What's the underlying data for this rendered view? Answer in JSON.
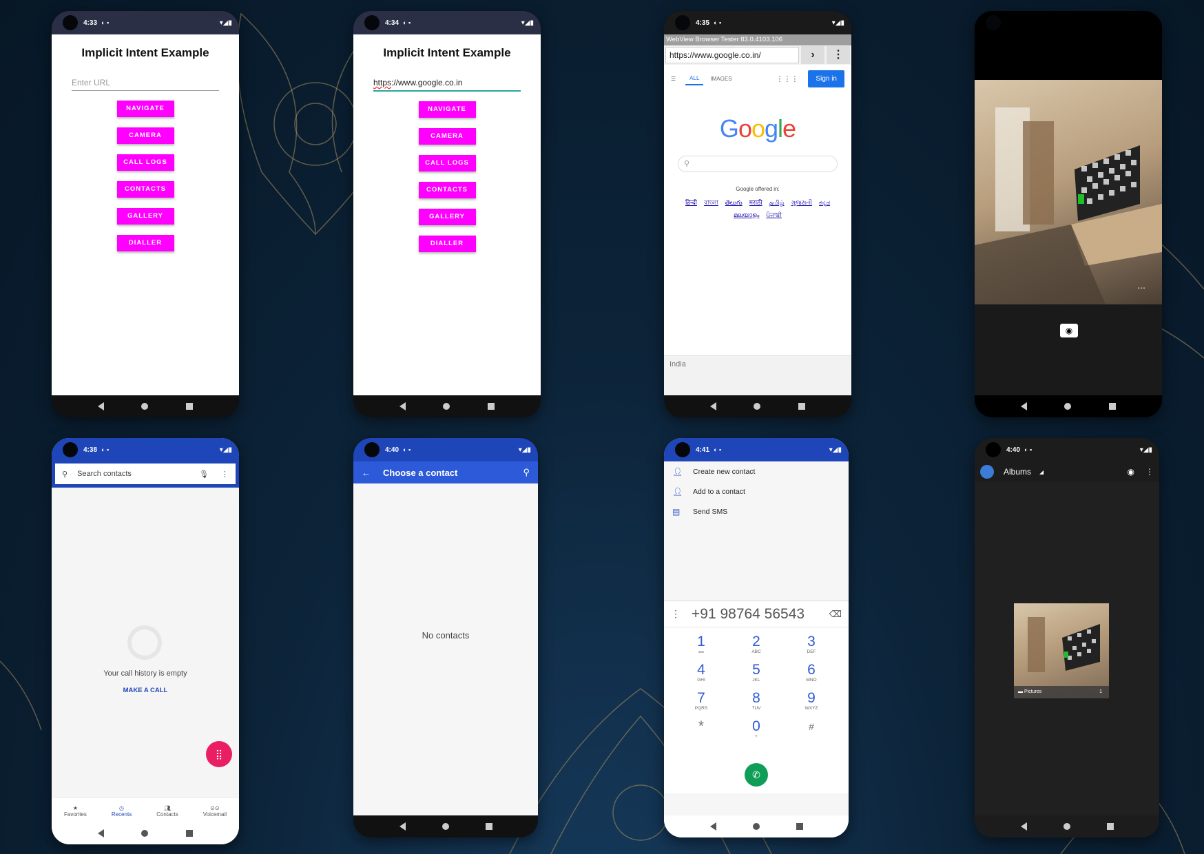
{
  "phones": {
    "p1": {
      "time": "4:33",
      "title": "Implicit Intent Example",
      "url_placeholder": "Enter URL",
      "buttons": [
        "NAVIGATE",
        "CAMERA",
        "CALL LOGS",
        "CONTACTS",
        "GALLERY",
        "DIALLER"
      ]
    },
    "p2": {
      "time": "4:34",
      "title": "Implicit Intent Example",
      "url_prefix": "https",
      "url_rest": "://www.google.co.in",
      "buttons": [
        "NAVIGATE",
        "CAMERA",
        "CALL LOGS",
        "CONTACTS",
        "GALLERY",
        "DIALLER"
      ]
    },
    "p3": {
      "time": "4:35",
      "tester": "WebView Browser Tester 83.0.4103.106",
      "url": "https://www.google.co.in/",
      "tab_all": "ALL",
      "tab_images": "IMAGES",
      "signin": "Sign in",
      "offered": "Google offered in:",
      "langs": [
        "हिन्दी",
        "বাংলা",
        "తెలుగు",
        "मराठी",
        "தமிழ்",
        "ગુજરાતી",
        "ಕನ್ನಡ",
        "മലയാളം",
        "ਪੰਜਾਬੀ"
      ],
      "country": "India"
    },
    "p5": {
      "time": "4:38",
      "search": "Search contacts",
      "empty": "Your call history is empty",
      "make_call": "MAKE A CALL",
      "tabs": [
        "Favorites",
        "Recents",
        "Contacts",
        "Voicemail"
      ]
    },
    "p6": {
      "time": "4:40",
      "title": "Choose a contact",
      "empty": "No contacts"
    },
    "p7": {
      "time": "4:41",
      "menu": [
        "Create new contact",
        "Add to a contact",
        "Send SMS"
      ],
      "number": "+91 98764 56543",
      "keys": [
        [
          "1",
          ""
        ],
        [
          "2",
          "ABC"
        ],
        [
          "3",
          "DEF"
        ],
        [
          "4",
          "GHI"
        ],
        [
          "5",
          "JKL"
        ],
        [
          "6",
          "MNO"
        ],
        [
          "7",
          "PQRS"
        ],
        [
          "8",
          "TUV"
        ],
        [
          "9",
          "WXYZ"
        ],
        [
          "*",
          ""
        ],
        [
          "0",
          "+"
        ],
        [
          "#",
          ""
        ]
      ]
    },
    "p8": {
      "time": "4:40",
      "title": "Albums",
      "album": "Pictures",
      "count": "1"
    }
  },
  "colors": {
    "button": "#ff00ff",
    "dialer_blue": "#1f46b8",
    "fab": "#e91e63",
    "call": "#0f9d58"
  }
}
